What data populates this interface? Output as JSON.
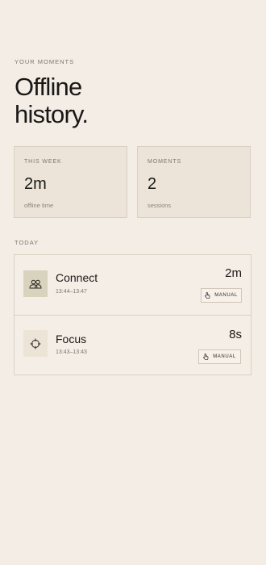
{
  "header": {
    "eyebrow": "YOUR MOMENTS",
    "title_line1": "Offline",
    "title_line2": "history."
  },
  "stats": [
    {
      "label": "THIS WEEK",
      "value": "2m",
      "sub": "offline time"
    },
    {
      "label": "MOMENTS",
      "value": "2",
      "sub": "sessions"
    }
  ],
  "section": {
    "today_label": "TODAY"
  },
  "moments": [
    {
      "name": "Connect",
      "time": "13:44–13:47",
      "duration": "2m",
      "badge": "MANUAL",
      "icon": "people-icon"
    },
    {
      "name": "Focus",
      "time": "13:43–13:43",
      "duration": "8s",
      "badge": "MANUAL",
      "icon": "crosshair-icon"
    }
  ],
  "colors": {
    "background": "#f4ede6",
    "card": "#ece4d8",
    "accent_icon_bg": "#d9d2bc",
    "border": "#d9d0c2"
  }
}
